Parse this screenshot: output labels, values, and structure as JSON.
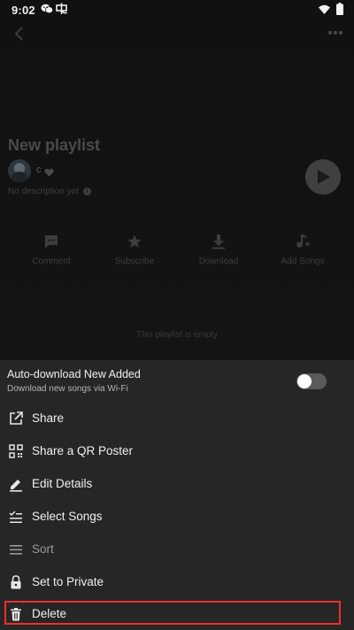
{
  "status_bar": {
    "time": "9:02",
    "icons": [
      "wechat-icon",
      "app-notification-icon",
      "wifi-icon",
      "battery-icon"
    ]
  },
  "header": {
    "back_icon": "chevron-left-icon",
    "more_icon": "more-dots-icon"
  },
  "playlist": {
    "title": "New playlist",
    "user": "c",
    "description": "No description yet",
    "play_icon": "play-icon"
  },
  "actions": [
    {
      "label": "Comment",
      "icon": "comment-icon"
    },
    {
      "label": "Subscribe",
      "icon": "star-icon"
    },
    {
      "label": "Download",
      "icon": "download-icon"
    },
    {
      "label": "Add Songs",
      "icon": "add-music-icon"
    }
  ],
  "empty_message": "This playlist is empty",
  "sheet": {
    "auto_download": {
      "title": "Auto-download New Added",
      "subtitle": "Download new songs via Wi-Fi",
      "enabled": false
    },
    "menu": [
      {
        "label": "Share",
        "icon": "share-icon"
      },
      {
        "label": "Share a QR Poster",
        "icon": "qr-code-icon"
      },
      {
        "label": "Edit Details",
        "icon": "edit-icon"
      },
      {
        "label": "Select Songs",
        "icon": "select-list-icon"
      },
      {
        "label": "Sort",
        "icon": "sort-icon",
        "disabled": true
      },
      {
        "label": "Set to Private",
        "icon": "lock-icon"
      },
      {
        "label": "Delete",
        "icon": "trash-icon",
        "highlighted": true
      }
    ]
  },
  "colors": {
    "highlight": "#e8322a",
    "sheet_bg": "#262626",
    "page_bg": "#111111"
  }
}
